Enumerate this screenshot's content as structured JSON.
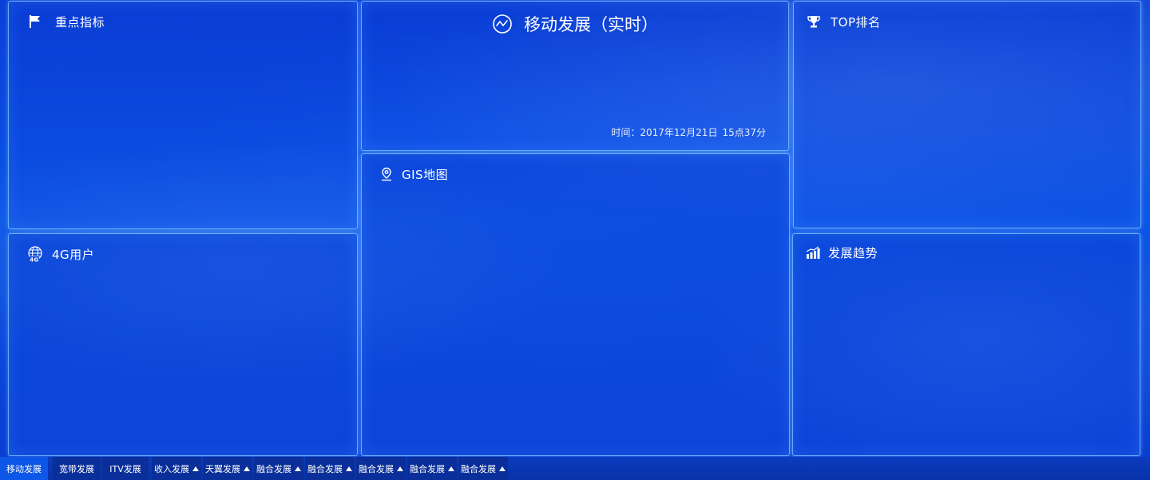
{
  "panels": {
    "key_indicators": {
      "title": "重点指标",
      "icon": "flag-icon"
    },
    "mobile_dev": {
      "title": "移动发展（实时）",
      "icon": "pulse-circle-icon",
      "time_label": "时间：",
      "time_date": "2017年12月21日",
      "time_clock": "15点37分"
    },
    "top_rank": {
      "title": "TOP排名",
      "icon": "trophy-icon"
    },
    "users_4g": {
      "title": "4G用户",
      "icon": "globe-4g-icon"
    },
    "gis_map": {
      "title": "GIS地图",
      "icon": "map-pin-icon"
    },
    "trend": {
      "title": "发展趋势",
      "icon": "bar-trend-icon"
    }
  },
  "bottom_nav": {
    "tabs": [
      {
        "label": "移动发展",
        "active": true,
        "has_arrow": false
      },
      {
        "label": "宽带发展",
        "active": false,
        "has_arrow": false
      },
      {
        "label": "ITV发展",
        "active": false,
        "has_arrow": false
      },
      {
        "label": "收入发展",
        "active": false,
        "has_arrow": true
      },
      {
        "label": "天翼发展",
        "active": false,
        "has_arrow": true
      },
      {
        "label": "融合发展",
        "active": false,
        "has_arrow": true
      },
      {
        "label": "融合发展",
        "active": false,
        "has_arrow": true
      },
      {
        "label": "融合发展",
        "active": false,
        "has_arrow": true
      },
      {
        "label": "融合发展",
        "active": false,
        "has_arrow": true
      },
      {
        "label": "融合发展",
        "active": false,
        "has_arrow": true
      }
    ]
  }
}
